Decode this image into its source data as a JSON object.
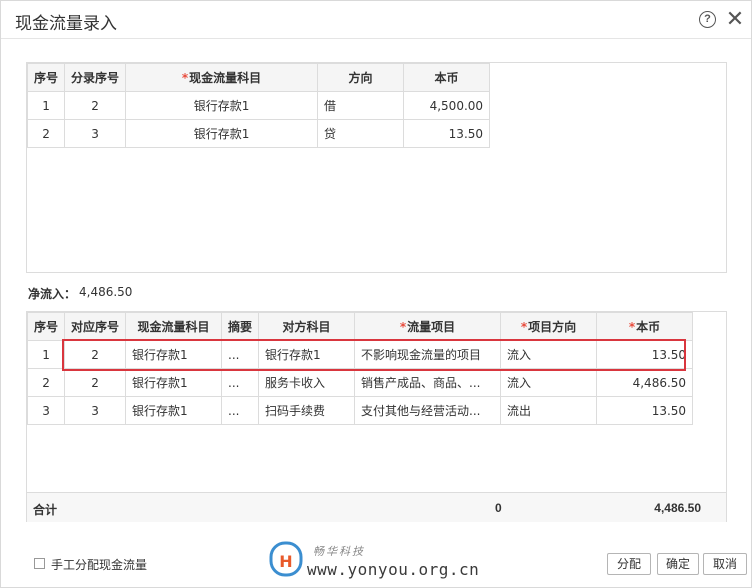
{
  "dialog": {
    "title": "现金流量录入",
    "help_icon": "?",
    "close_icon": "✕"
  },
  "upper_table": {
    "headers": {
      "seq": "序号",
      "entry_seq": "分录序号",
      "required_mark": "*",
      "cash_subject": "现金流量科目",
      "direction": "方向",
      "amount": "本币"
    },
    "rows": [
      {
        "seq": "1",
        "entry_seq": "2",
        "cash_subject": "银行存款1",
        "direction": "借",
        "amount": "4,500.00"
      },
      {
        "seq": "2",
        "entry_seq": "3",
        "cash_subject": "银行存款1",
        "direction": "贷",
        "amount": "13.50"
      }
    ]
  },
  "net_inflow": {
    "label": "净流入：",
    "value": "4,486.50"
  },
  "lower_table": {
    "headers": {
      "seq": "序号",
      "entry_seq": "对应序号",
      "cash_subject": "现金流量科目",
      "summary": "摘要",
      "counter_subject": "对方科目",
      "required_mark": "*",
      "flow_item": "流量项目",
      "item_direction": "项目方向",
      "amount": "本币"
    },
    "rows": [
      {
        "seq": "1",
        "entry_seq": "2",
        "cash_subject": "银行存款1",
        "summary": "...",
        "counter_subject": "银行存款1",
        "flow_item": "不影响现金流量的项目",
        "item_direction": "流入",
        "amount": "13.50"
      },
      {
        "seq": "2",
        "entry_seq": "2",
        "cash_subject": "银行存款1",
        "summary": "...",
        "counter_subject": "服务卡收入",
        "flow_item": "销售产成品、商品、...",
        "item_direction": "流入",
        "amount": "4,486.50"
      },
      {
        "seq": "3",
        "entry_seq": "3",
        "cash_subject": "银行存款1",
        "summary": "...",
        "counter_subject": "扫码手续费",
        "flow_item": "支付其他与经营活动...",
        "item_direction": "流出",
        "amount": "13.50"
      }
    ],
    "total": {
      "label": "合计",
      "zero": "0",
      "amount": "4,486.50"
    }
  },
  "footer": {
    "checkbox_label": "手工分配现金流量",
    "assign_button": "分配",
    "ok_button": "确定",
    "cancel_button": "取消"
  },
  "watermark": {
    "company": "畅华科技",
    "url": "www.yonyou.org.cn"
  },
  "colors": {
    "highlight": "#d9363e",
    "required": "#e84c3d",
    "header_bg": "#f5f5f5",
    "border": "#dcdcdc"
  }
}
